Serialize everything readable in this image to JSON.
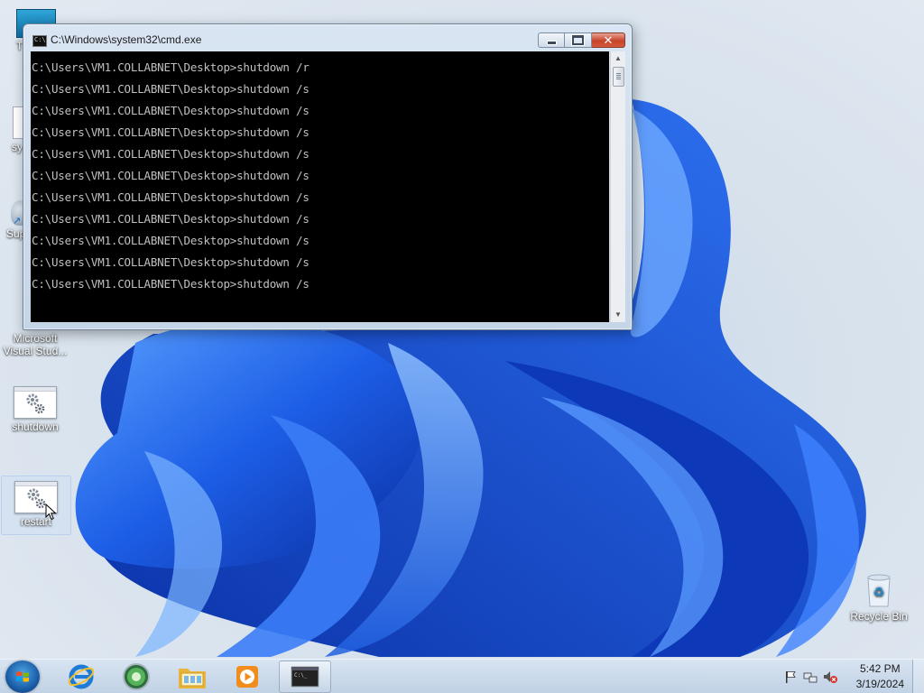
{
  "desktop": {
    "icons": [
      {
        "label": "T",
        "icon": "partial-icon"
      },
      {
        "label": "sy",
        "icon": "partial-icon"
      },
      {
        "label": "Sup",
        "icon": "shortcut-icon"
      },
      {
        "label": "Microsoft Visual Stud...",
        "icon": "visual-studio-icon"
      },
      {
        "label": "shutdown",
        "icon": "batch-file-icon"
      },
      {
        "label": "restart",
        "icon": "batch-file-icon"
      },
      {
        "label": "Recycle Bin",
        "icon": "recycle-bin-icon"
      }
    ]
  },
  "cmd_window": {
    "title": "C:\\Windows\\system32\\cmd.exe",
    "lines": [
      "C:\\Users\\VM1.COLLABNET\\Desktop>shutdown /r",
      "C:\\Users\\VM1.COLLABNET\\Desktop>shutdown /s",
      "C:\\Users\\VM1.COLLABNET\\Desktop>shutdown /s",
      "C:\\Users\\VM1.COLLABNET\\Desktop>shutdown /s",
      "C:\\Users\\VM1.COLLABNET\\Desktop>shutdown /s",
      "C:\\Users\\VM1.COLLABNET\\Desktop>shutdown /s",
      "C:\\Users\\VM1.COLLABNET\\Desktop>shutdown /s",
      "C:\\Users\\VM1.COLLABNET\\Desktop>shutdown /s",
      "C:\\Users\\VM1.COLLABNET\\Desktop>shutdown /s",
      "C:\\Users\\VM1.COLLABNET\\Desktop>shutdown /s",
      "C:\\Users\\VM1.COLLABNET\\Desktop>shutdown /s"
    ]
  },
  "taskbar": {
    "pinned": [
      {
        "name": "internet-explorer-icon"
      },
      {
        "name": "media-center-icon"
      },
      {
        "name": "file-explorer-icon"
      },
      {
        "name": "media-player-icon"
      },
      {
        "name": "cmd-icon"
      }
    ],
    "clock": {
      "time": "5:42 PM",
      "date": "3/19/2024"
    }
  },
  "colors": {
    "wallpaper_accent": "#1a56d8",
    "console_bg": "#000000",
    "console_text": "#c0c0c0"
  }
}
